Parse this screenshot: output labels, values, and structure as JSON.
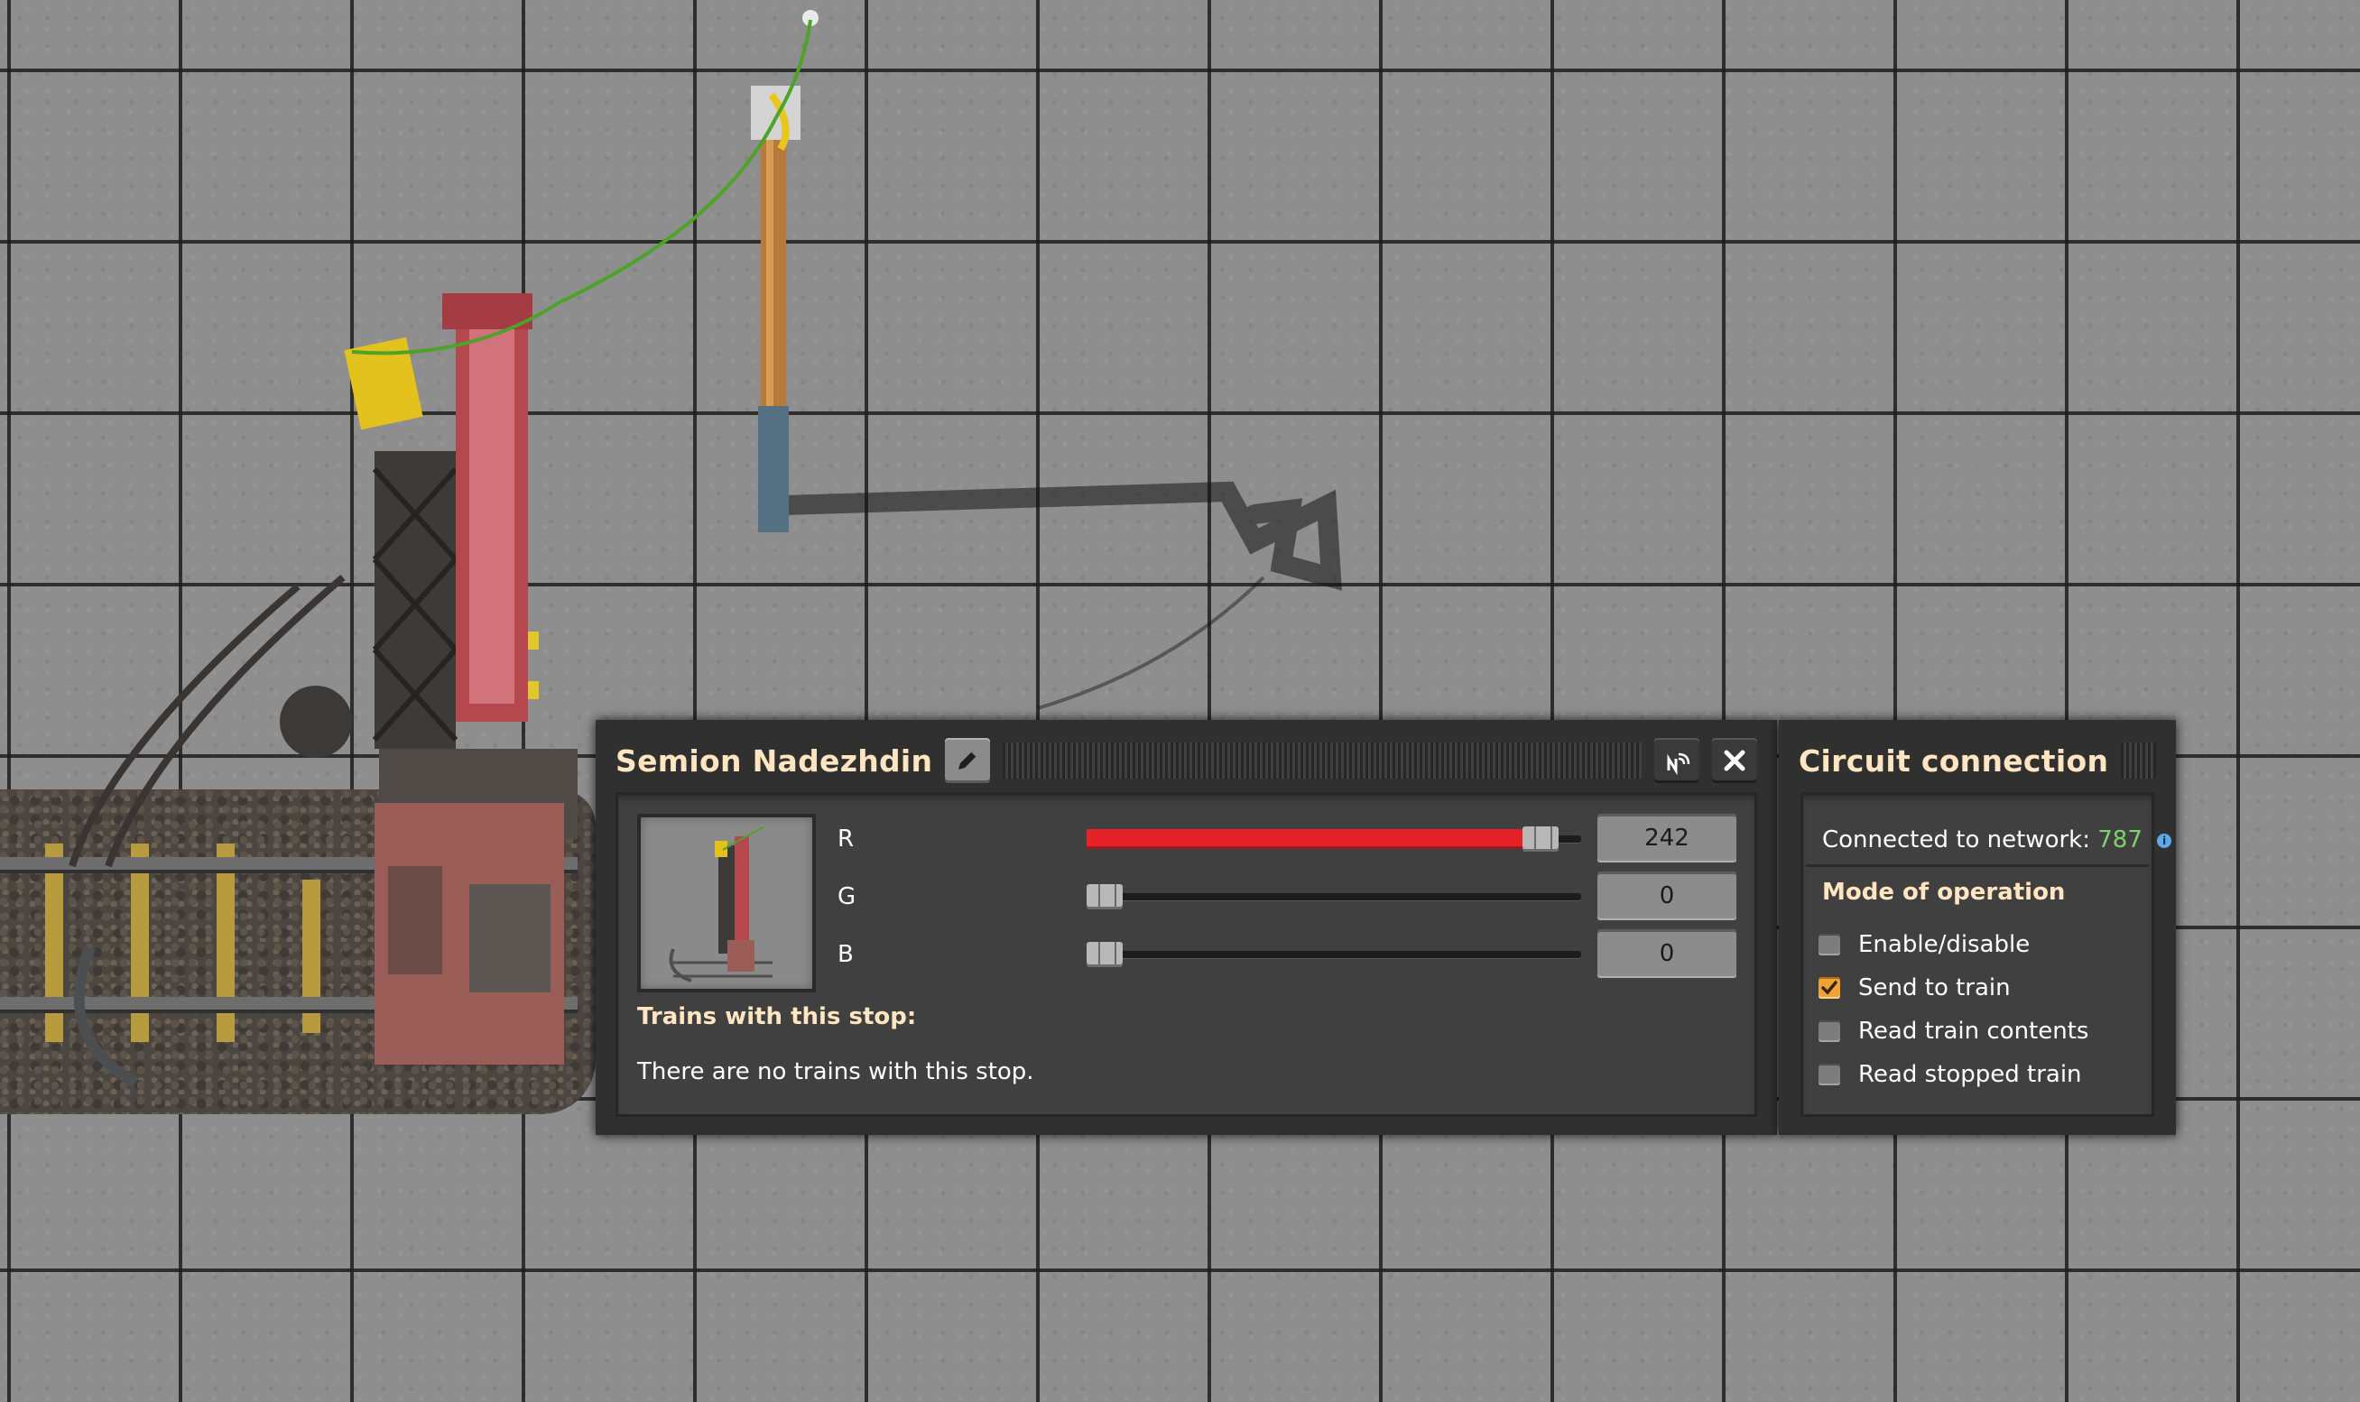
{
  "station_window": {
    "title": "Semion Nadezhdin",
    "edit_icon": "pencil-icon",
    "map_icon": "radar-icon",
    "close_icon": "close-icon",
    "color": {
      "r": {
        "label": "R",
        "value": "242",
        "fraction": 0.95
      },
      "g": {
        "label": "G",
        "value": "0",
        "fraction": 0.0
      },
      "b": {
        "label": "B",
        "value": "0",
        "fraction": 0.0
      }
    },
    "trains_heading": "Trains with this stop:",
    "trains_empty_text": "There are no trains with this stop."
  },
  "circuit_window": {
    "title": "Circuit connection",
    "network_label": "Connected to network:",
    "network_id": "787",
    "mode_heading": "Mode of operation",
    "options": [
      {
        "label": "Enable/disable",
        "checked": false
      },
      {
        "label": "Send to train",
        "checked": true
      },
      {
        "label": "Read train contents",
        "checked": false
      },
      {
        "label": "Read stopped train",
        "checked": false
      }
    ]
  },
  "colors": {
    "heading": "#ffe6c0",
    "network_id": "#7ed26a",
    "slider_fill": "#e52227",
    "checkbox_checked": "#f1a339"
  }
}
